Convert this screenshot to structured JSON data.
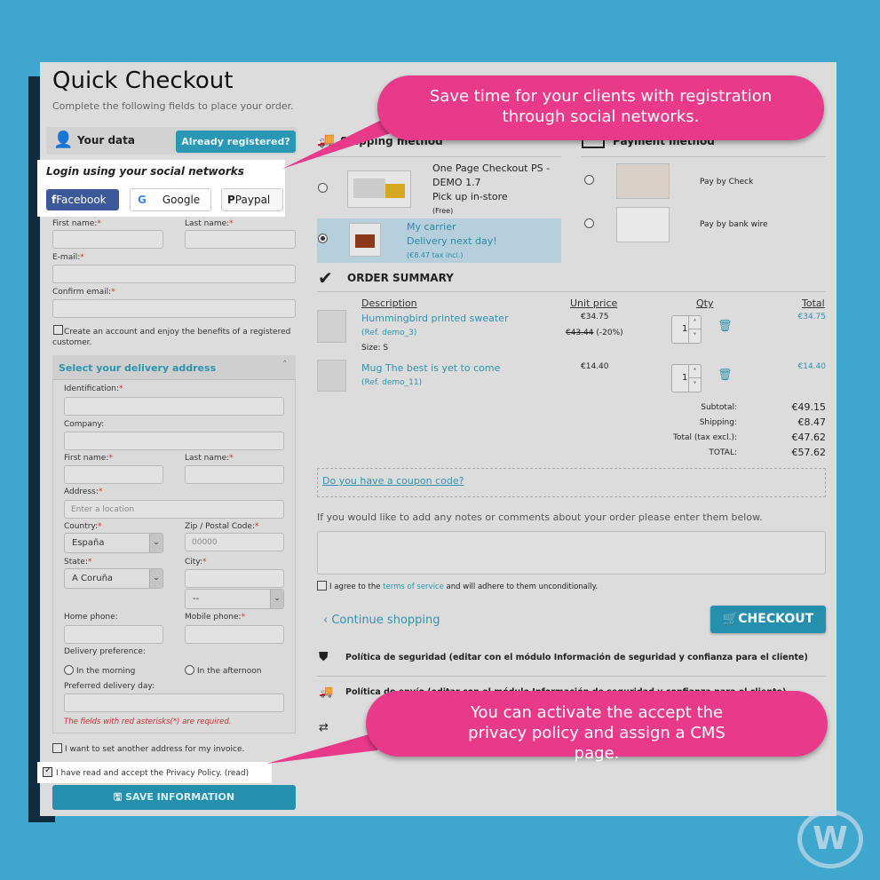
{
  "page": {
    "title": "Quick Checkout",
    "subtitle": "Complete the following fields to place your order."
  },
  "your_data": {
    "title": "Your data",
    "already_registered": "Already registered?",
    "social": {
      "title": "Login using your social networks",
      "facebook": "Facebook",
      "google": "Google",
      "paypal": "Paypal"
    },
    "first_name": "First name:",
    "last_name": "Last name:",
    "email": "E-mail:",
    "confirm_email": "Confirm email:",
    "create_account": "Create an account and enjoy the benefits of a registered customer."
  },
  "delivery": {
    "title": "Select your delivery address",
    "identification": "Identification:",
    "company": "Company:",
    "first_name": "First name:",
    "last_name": "Last name:",
    "address": "Address:",
    "address_placeholder": "Enter a location",
    "country": "Country:",
    "country_value": "España",
    "zip": "Zip / Postal Code:",
    "zip_placeholder": "00000",
    "state": "State:",
    "state_value": "A Coruña",
    "city": "City:",
    "city_select": "--",
    "home_phone": "Home phone:",
    "mobile_phone": "Mobile phone:",
    "delivery_pref": "Delivery preference:",
    "morning": "In the morning",
    "afternoon": "In the afternoon",
    "preferred_day": "Preferred delivery day:",
    "required_note": "The fields with red asterisks(*) are required."
  },
  "invoice_address": "I want to set another address for my invoice.",
  "privacy": "I have read and accept the Privacy Policy. (read)",
  "save": "SAVE INFORMATION",
  "shipping": {
    "title": "Shipping method",
    "options": [
      {
        "name": "One Page Checkout PS - DEMO 1.7",
        "desc": "Pick up in-store",
        "price": "(Free)",
        "selected": false
      },
      {
        "name": "My carrier",
        "desc": "Delivery next day!",
        "price": "(€8.47 tax incl.)",
        "selected": true
      }
    ]
  },
  "payment": {
    "title": "Payment method",
    "options": [
      {
        "name": "Pay by Check"
      },
      {
        "name": "Pay by bank wire"
      }
    ]
  },
  "summary": {
    "title": "ORDER SUMMARY",
    "headers": {
      "description": "Description",
      "unit_price": "Unit price",
      "qty": "Qty",
      "total": "Total"
    },
    "items": [
      {
        "name": "Hummingbird printed sweater",
        "ref": "(Ref. demo_3)",
        "size": "Size: S",
        "price": "€34.75",
        "old_price": "€43.44",
        "discount": "(-20%)",
        "qty": "1",
        "total": "€34.75"
      },
      {
        "name": "Mug The best is yet to come",
        "ref": "(Ref. demo_11)",
        "price": "€14.40",
        "qty": "1",
        "total": "€14.40"
      }
    ],
    "subtotal_label": "Subtotal:",
    "subtotal": "€49.15",
    "shipping_label": "Shipping:",
    "shipping": "€8.47",
    "tax_excl_label": "Total (tax excl.):",
    "tax_excl": "€47.62",
    "total_label": "TOTAL:",
    "total": "€57.62"
  },
  "coupon": "Do you have a coupon code?",
  "notes_label": "If you would like to add any notes or comments about your order please enter them below.",
  "terms": {
    "pre": "I agree to the ",
    "link": "terms of service",
    "post": " and will adhere to them unconditionally."
  },
  "continue": "Continue shopping",
  "checkout": "CHECKOUT",
  "policies": [
    "Política de seguridad (editar con el módulo Información de seguridad y confianza para el cliente)",
    "Política de envío (editar con el módulo Información de seguridad y confianza para el cliente)"
  ],
  "callouts": {
    "social": "Save time for your clients with registration through social networks.",
    "privacy": "You can activate the accept the privacy policy and assign a CMS page."
  },
  "colors": {
    "background": "#3fa7cd",
    "accent": "#2590ae",
    "callout": "#e8398a",
    "facebook": "#3b5998"
  },
  "watermark": "W"
}
